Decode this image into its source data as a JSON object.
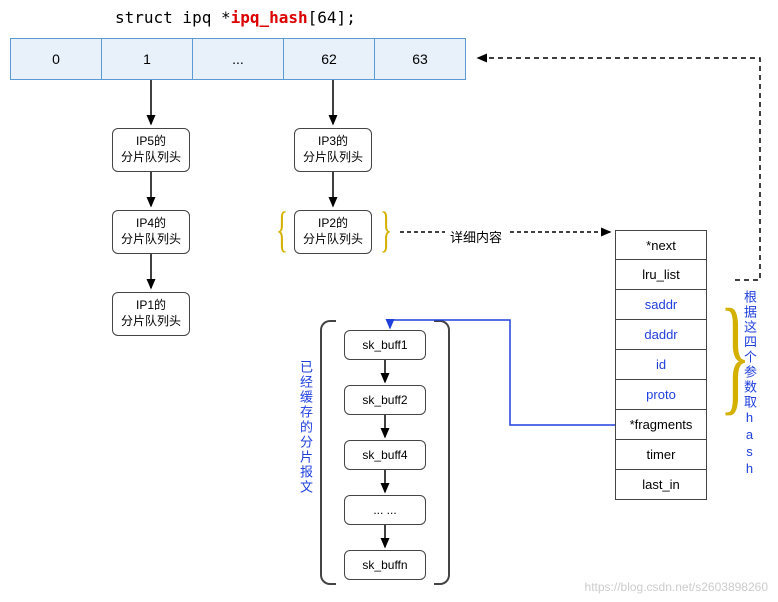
{
  "title": {
    "prefix": "struct ipq *",
    "name": "ipq_hash",
    "suffix": "[64];"
  },
  "hash_cells": [
    "0",
    "1",
    "...",
    "62",
    "63"
  ],
  "chain1": [
    "IP5的\n分片队列头",
    "IP4的\n分片队列头",
    "IP1的\n分片队列头"
  ],
  "chain62": [
    "IP3的\n分片队列头",
    "IP2的\n分片队列头"
  ],
  "detail_label": "详细内容",
  "struct_fields": [
    {
      "t": "*next",
      "c": false
    },
    {
      "t": "lru_list",
      "c": false
    },
    {
      "t": "saddr",
      "c": true
    },
    {
      "t": "daddr",
      "c": true
    },
    {
      "t": "id",
      "c": true
    },
    {
      "t": "proto",
      "c": true
    },
    {
      "t": "*fragments",
      "c": false
    },
    {
      "t": "timer",
      "c": false
    },
    {
      "t": "last_in",
      "c": false
    }
  ],
  "skbuffs": [
    "sk_buff1",
    "sk_buff2",
    "sk_buff4",
    "... ...",
    "sk_buffn"
  ],
  "left_caption": "已经缓存的分片报文",
  "right_caption": "根据这四个参数取hash",
  "watermark": "https://blog.csdn.net/s2603898260"
}
